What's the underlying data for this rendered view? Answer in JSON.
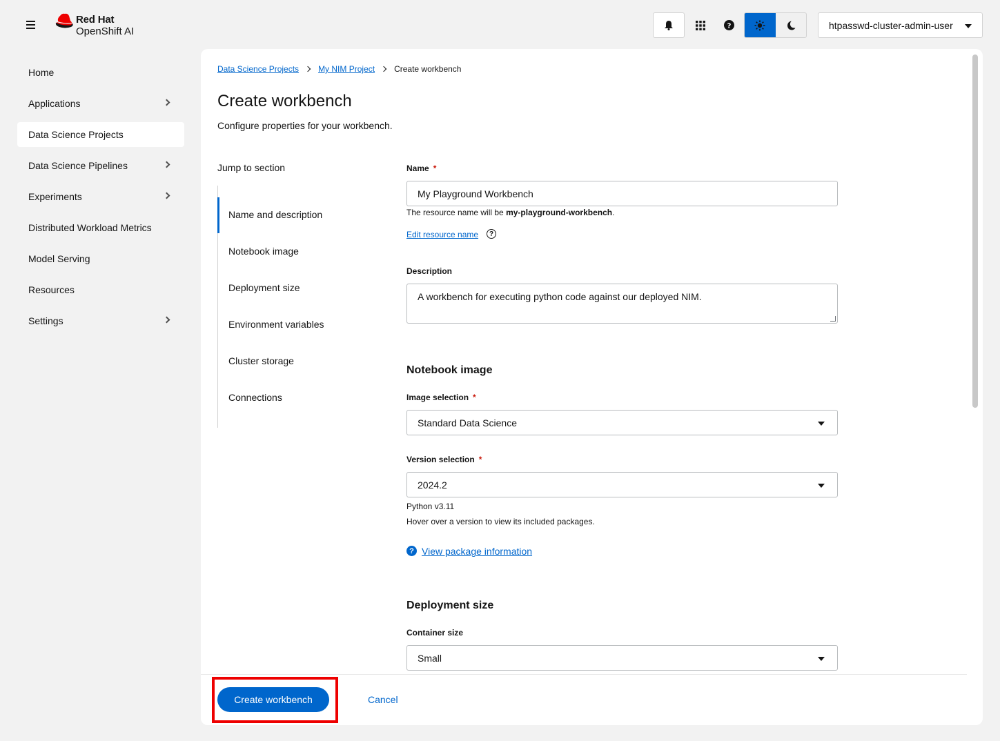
{
  "brand": {
    "line1": "Red Hat",
    "line2": "OpenShift AI"
  },
  "user": {
    "name": "htpasswd-cluster-admin-user"
  },
  "nav": {
    "items": [
      {
        "label": "Home",
        "expandable": false,
        "active": false
      },
      {
        "label": "Applications",
        "expandable": true,
        "active": false
      },
      {
        "label": "Data Science Projects",
        "expandable": false,
        "active": true
      },
      {
        "label": "Data Science Pipelines",
        "expandable": true,
        "active": false
      },
      {
        "label": "Experiments",
        "expandable": true,
        "active": false
      },
      {
        "label": "Distributed Workload Metrics",
        "expandable": false,
        "active": false
      },
      {
        "label": "Model Serving",
        "expandable": false,
        "active": false
      },
      {
        "label": "Resources",
        "expandable": false,
        "active": false
      },
      {
        "label": "Settings",
        "expandable": true,
        "active": false
      }
    ]
  },
  "breadcrumb": {
    "projects": "Data Science Projects",
    "project": "My NIM Project",
    "current": "Create workbench"
  },
  "page": {
    "title": "Create workbench",
    "subtitle": "Configure properties for your workbench."
  },
  "jump": {
    "title": "Jump to section",
    "items": [
      "Name and description",
      "Notebook image",
      "Deployment size",
      "Environment variables",
      "Cluster storage",
      "Connections"
    ]
  },
  "form": {
    "name_label": "Name",
    "required_mark": "*",
    "name_value": "My Playground Workbench",
    "resource_prefix": "The resource name will be ",
    "resource_name": "my-playground-workbench",
    "resource_suffix": ".",
    "edit_resource_link": "Edit resource name",
    "help_glyph": "?",
    "description_label": "Description",
    "description_value": "A workbench for executing python code against our deployed NIM.",
    "notebook_section": "Notebook image",
    "image_label": "Image selection",
    "image_value": "Standard Data Science",
    "version_label": "Version selection",
    "version_value": "2024.2",
    "python_version": "Python v3.11",
    "hover_hint": "Hover over a version to view its included packages.",
    "package_link": "View package information",
    "deployment_section": "Deployment size",
    "container_label": "Container size",
    "container_value": "Small"
  },
  "footer": {
    "create_label": "Create workbench",
    "cancel_label": "Cancel"
  },
  "colors": {
    "accent": "#0066cc",
    "highlight": "#ee0000",
    "required": "#c9190b"
  }
}
